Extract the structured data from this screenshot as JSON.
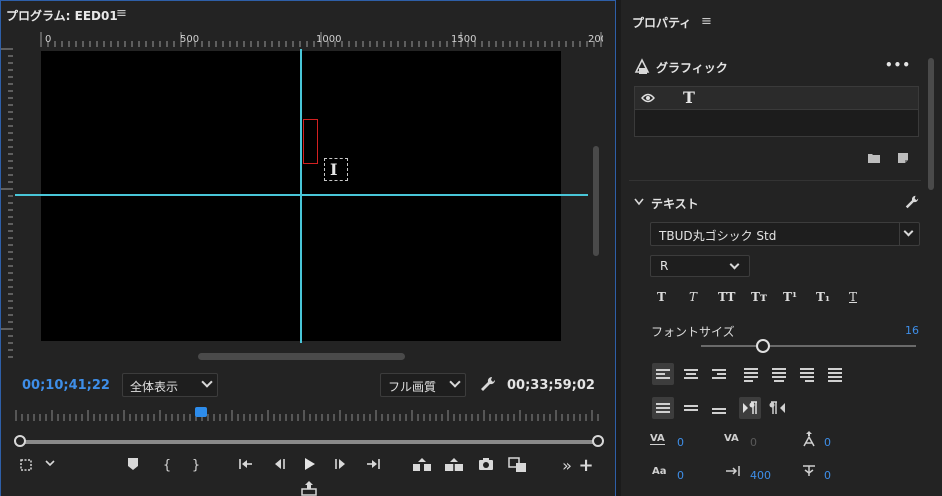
{
  "program_panel": {
    "title": "プログラム: EED01",
    "menu_icon": "≡",
    "ruler_h_labels": [
      "0",
      "500",
      "1000",
      "1500",
      "200"
    ],
    "timecode_current": "00;10;41;22",
    "timecode_duration": "00;33;59;02",
    "zoom_dropdown": "全体表示",
    "quality_dropdown": "フル画質",
    "playhead_fraction": 0.31,
    "icons": [
      "wrench-icon",
      "marker-icon",
      "in-point-icon",
      "out-point-icon",
      "go-to-in-icon",
      "step-back-icon",
      "play-icon",
      "step-forward-icon",
      "go-to-out-icon",
      "lift-icon",
      "extract-icon",
      "camera-icon",
      "compare-icon",
      "more-icon",
      "add-icon",
      "export-frame-icon"
    ],
    "ctrl_labels": {
      "in": "{",
      "out": "}",
      "more": "»",
      "add": "+"
    }
  },
  "properties_panel": {
    "title": "プロパティ",
    "menu_icon": "≡",
    "graphic": {
      "title": "グラフィック",
      "more": "•••",
      "row_type_glyph": "T"
    },
    "text": {
      "title": "テキスト",
      "font_family": "TBUD丸ゴシック Std",
      "font_style": "R",
      "format_buttons": [
        "T",
        "T",
        "TT",
        "Tт",
        "T¹",
        "T₁",
        "T"
      ],
      "font_size_label": "フォントサイズ",
      "font_size_value": "16",
      "font_size_fraction": 0.29,
      "tracking_label": "VA",
      "tracking_value": "0",
      "kerning_label": "VA",
      "kerning_value": "0",
      "baseline_value": "0",
      "line3_value_1": "0",
      "line3_value_2": "400",
      "line3_value_3": "0",
      "line3_label_1": "Aa"
    }
  },
  "colors": {
    "guide": "#49c6d8",
    "accent": "#3e8ee8",
    "selection_box": "#d32121",
    "panel_border": "#2e5fa8"
  }
}
